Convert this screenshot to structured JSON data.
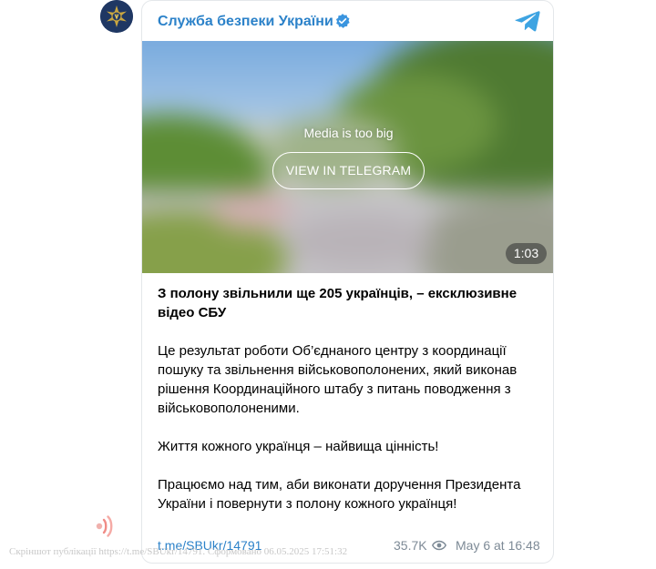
{
  "channel": {
    "name": "Служба безпеки України",
    "verified": true,
    "avatar_icon": "sbu-emblem-icon",
    "brand_color": "#2c82c9"
  },
  "media": {
    "notice": "Media is too big",
    "button_label": "VIEW IN TELEGRAM",
    "duration": "1:03"
  },
  "post": {
    "headline": "З полону звільнили ще 205 українців, – ексклюзивне відео СБУ",
    "paragraphs": [
      "Це результат роботи Об’єднаного центру з координації пошуку та звільнення військовополонених, який виконав рішення Координаційного штабу з питань поводження з військовополоненими.",
      "Життя кожного українця – найвища цінність!",
      "Працюємо над тим, аби виконати доручення Президента України і повернути з полону кожного українця!"
    ]
  },
  "footer": {
    "link": "t.me/SBUkr/14791",
    "views": "35.7K",
    "date": "May 6 at 16:48"
  },
  "watermark": {
    "text": "Скріншот публікації https://t.me/SBUkr/14791. Сформовано 06.05.2025 17:51:32"
  }
}
